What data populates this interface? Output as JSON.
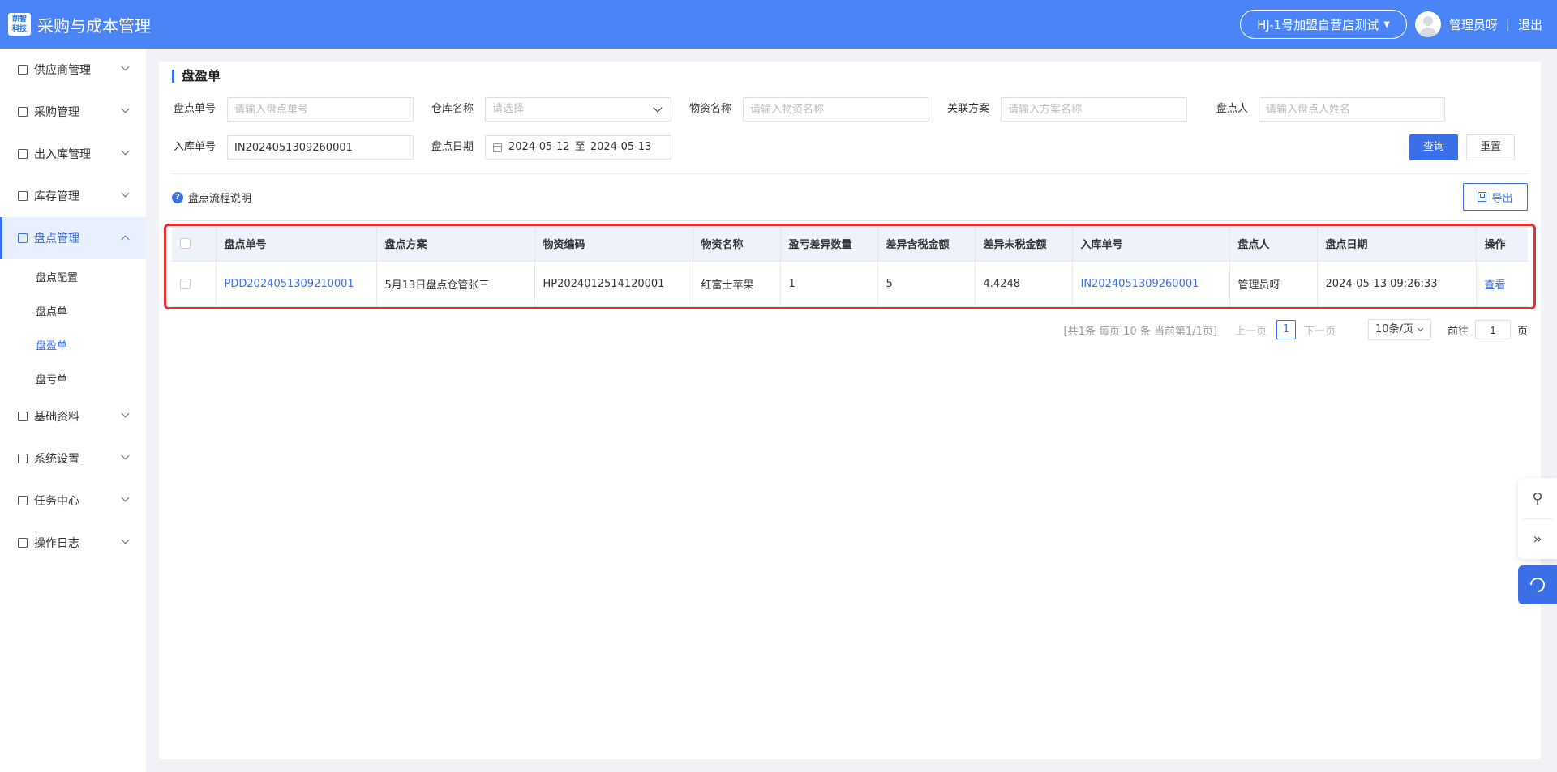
{
  "header": {
    "logo_line1": "凯智",
    "logo_line2": "科技",
    "app_title": "采购与成本管理",
    "store_label": "HJ-1号加盟自营店测试",
    "user_name": "管理员呀",
    "separator": "|",
    "logout_label": "退出"
  },
  "sidebar": {
    "items": [
      {
        "label": "供应商管理"
      },
      {
        "label": "采购管理"
      },
      {
        "label": "出入库管理"
      },
      {
        "label": "库存管理"
      },
      {
        "label": "盘点管理"
      },
      {
        "label": "基础资料"
      },
      {
        "label": "系统设置"
      },
      {
        "label": "任务中心"
      },
      {
        "label": "操作日志"
      }
    ],
    "sub_items": [
      {
        "label": "盘点配置"
      },
      {
        "label": "盘点单"
      },
      {
        "label": "盘盈单"
      },
      {
        "label": "盘亏单"
      }
    ]
  },
  "page": {
    "title": "盘盈单"
  },
  "filters": {
    "count_no_label": "盘点单号",
    "count_no_placeholder": "请输入盘点单号",
    "warehouse_label": "仓库名称",
    "warehouse_placeholder": "请选择",
    "material_label": "物资名称",
    "material_placeholder": "请输入物资名称",
    "plan_label": "关联方案",
    "plan_placeholder": "请输入方案名称",
    "counter_label": "盘点人",
    "counter_placeholder": "请输入盘点人姓名",
    "inbound_label": "入库单号",
    "inbound_value": "IN2024051309260001",
    "date_label": "盘点日期",
    "date_start": "2024-05-12",
    "date_sep": "至",
    "date_end": "2024-05-13",
    "query_label": "查询",
    "reset_label": "重置"
  },
  "toolbar": {
    "help_icon": "?",
    "help_label": "盘点流程说明",
    "export_label": "导出"
  },
  "table": {
    "columns": [
      "盘点单号",
      "盘点方案",
      "物资编码",
      "物资名称",
      "盈亏差异数量",
      "差异含税金额",
      "差异未税金额",
      "入库单号",
      "盘点人",
      "盘点日期",
      "操作"
    ],
    "rows": [
      {
        "count_no": "PDD2024051309210001",
        "plan": "5月13日盘点仓管张三",
        "material_code": "HP2024012514120001",
        "material_name": "红富士苹果",
        "diff_qty": "1",
        "diff_tax_amount": "5",
        "diff_notax_amount": "4.4248",
        "inbound_no": "IN2024051309260001",
        "counter": "管理员呀",
        "date": "2024-05-13 09:26:33",
        "action": "查看"
      }
    ]
  },
  "pagination": {
    "info": "[共1条 每页 10 条 当前第1/1页]",
    "prev": "上一页",
    "current": "1",
    "next": "下一页",
    "page_size": "10条/页",
    "goto_label": "前往",
    "goto_value": "1",
    "goto_unit": "页"
  },
  "float_tools": {
    "link_icon": "link-icon",
    "collapse_icon": "double-chevron-right-icon",
    "support_icon": "headset-icon",
    "collapse_glyph": "»",
    "link_glyph": "⚲"
  },
  "colors": {
    "header_bg": "#4a84f6",
    "accent": "#3a6fe8",
    "highlight_frame": "#ea2d2d"
  }
}
